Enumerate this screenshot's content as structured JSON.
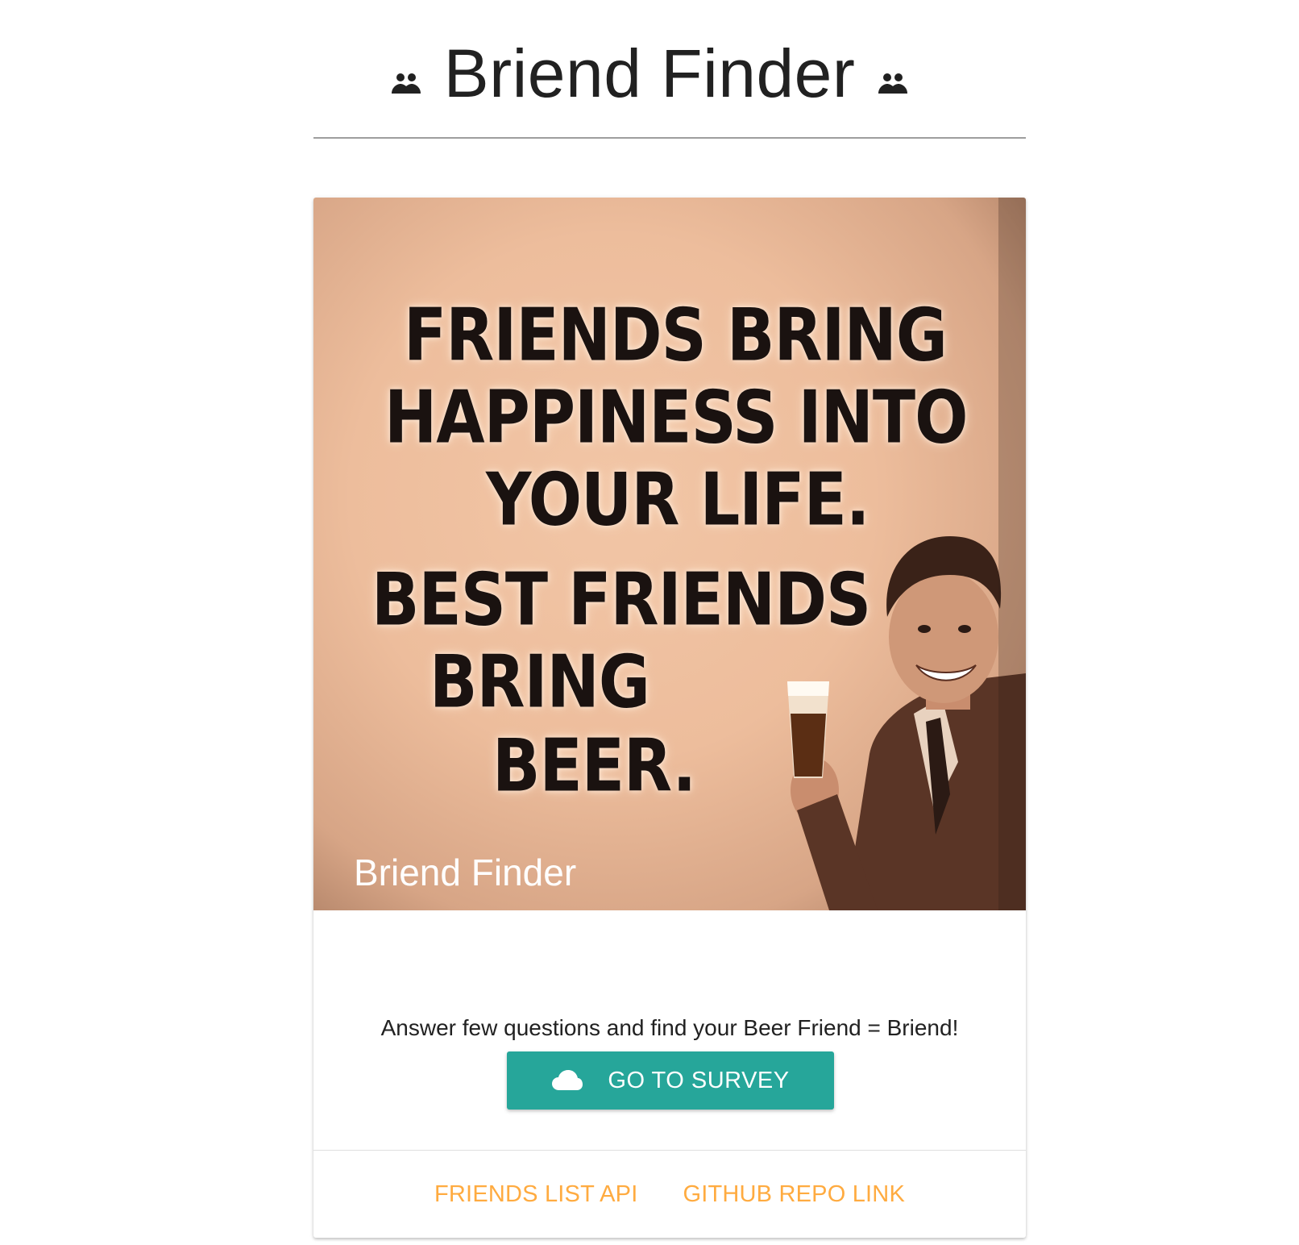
{
  "header": {
    "title": "Briend Finder",
    "icon_left": "people-icon",
    "icon_right": "people-icon"
  },
  "card": {
    "image": {
      "quote_lines": [
        "FRIENDS BRING",
        "HAPPINESS INTO",
        "YOUR LIFE.",
        "BEST FRIENDS",
        "BRING",
        "BEER."
      ],
      "title": "Briend Finder"
    },
    "content": {
      "text": "Answer few questions and find your Beer Friend = Briend!",
      "button_label": "GO TO SURVEY",
      "button_icon": "cloud-icon"
    },
    "actions": {
      "friends_list_label": "FRIENDS LIST API",
      "github_label": "GITHUB REPO LINK"
    }
  },
  "colors": {
    "button": "#26a69a",
    "link": "#ffab40",
    "title": "#212121"
  }
}
